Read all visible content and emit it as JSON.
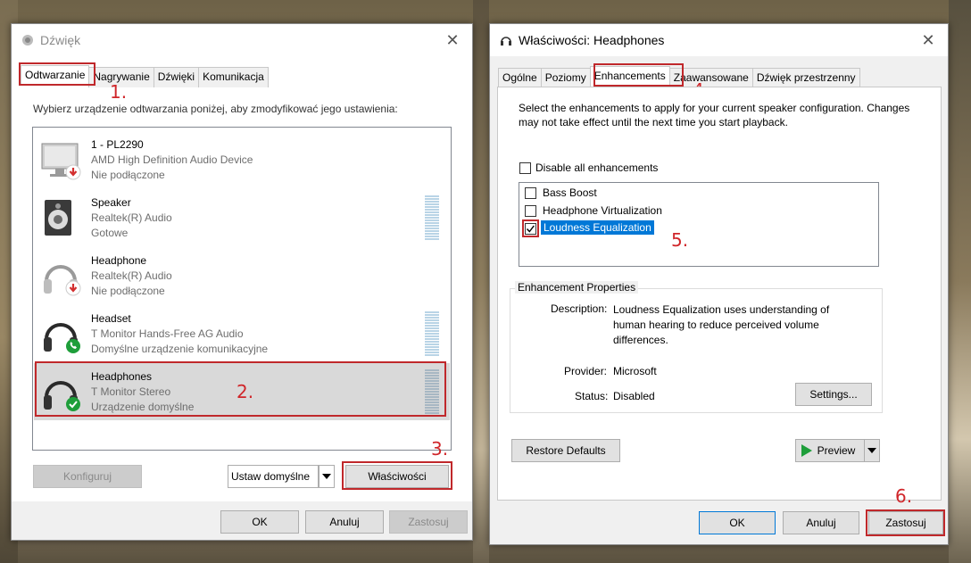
{
  "dialog1": {
    "title": "Dźwięk",
    "tabs": [
      "Odtwarzanie",
      "Nagrywanie",
      "Dźwięki",
      "Komunikacja"
    ],
    "instruction": "Wybierz urządzenie odtwarzania poniżej, aby zmodyfikować jego ustawienia:",
    "devices": [
      {
        "name": "1 - PL2290",
        "line1": "AMD High Definition Audio Device",
        "line2": "Nie podłączone",
        "icon": "monitor-icon",
        "status": "disconnected"
      },
      {
        "name": "Speaker",
        "line1": "Realtek(R) Audio",
        "line2": "Gotowe",
        "icon": "speaker-icon",
        "status": "ready"
      },
      {
        "name": "Headphone",
        "line1": "Realtek(R) Audio",
        "line2": "Nie podłączone",
        "icon": "headphone-icon",
        "status": "disconnected"
      },
      {
        "name": "Headset",
        "line1": "T Monitor Hands-Free AG Audio",
        "line2": "Domyślne urządzenie komunikacyjne",
        "icon": "headset-icon",
        "status": "communication-default"
      },
      {
        "name": "Headphones",
        "line1": "T Monitor Stereo",
        "line2": "Urządzenie domyślne",
        "icon": "headphones-icon",
        "status": "default"
      }
    ],
    "buttons": {
      "configure": "Konfiguruj",
      "set_default": "Ustaw domyślne",
      "properties": "Właściwości",
      "ok": "OK",
      "cancel": "Anuluj",
      "apply": "Zastosuj"
    }
  },
  "dialog2": {
    "title": "Właściwości: Headphones",
    "tabs": [
      "Ogólne",
      "Poziomy",
      "Enhancements",
      "Zaawansowane",
      "Dźwięk przestrzenny"
    ],
    "intro": "Select the enhancements to apply for your current speaker configuration. Changes may not take effect until the next time you start playback.",
    "disable_all": "Disable all enhancements",
    "enhancements": [
      {
        "label": "Bass Boost",
        "checked": false
      },
      {
        "label": "Headphone Virtualization",
        "checked": false
      },
      {
        "label": "Loudness Equalization",
        "checked": true
      }
    ],
    "properties_group": "Enhancement Properties",
    "description_label": "Description:",
    "description_text": "Loudness Equalization uses understanding of human hearing to reduce perceived volume differences.",
    "provider_label": "Provider:",
    "provider_value": "Microsoft",
    "status_label": "Status:",
    "status_value": "Disabled",
    "buttons": {
      "settings": "Settings...",
      "restore": "Restore Defaults",
      "preview": "Preview",
      "ok": "OK",
      "cancel": "Anuluj",
      "apply": "Zastosuj"
    }
  },
  "annotations": [
    "1.",
    "2.",
    "3.",
    "4.",
    "5.",
    "6."
  ],
  "colors": {
    "annotation_red": "#c0282b",
    "selection_blue": "#0078d7",
    "ok_green": "#1e9e3a",
    "disconnected_red": "#d32f2f"
  }
}
